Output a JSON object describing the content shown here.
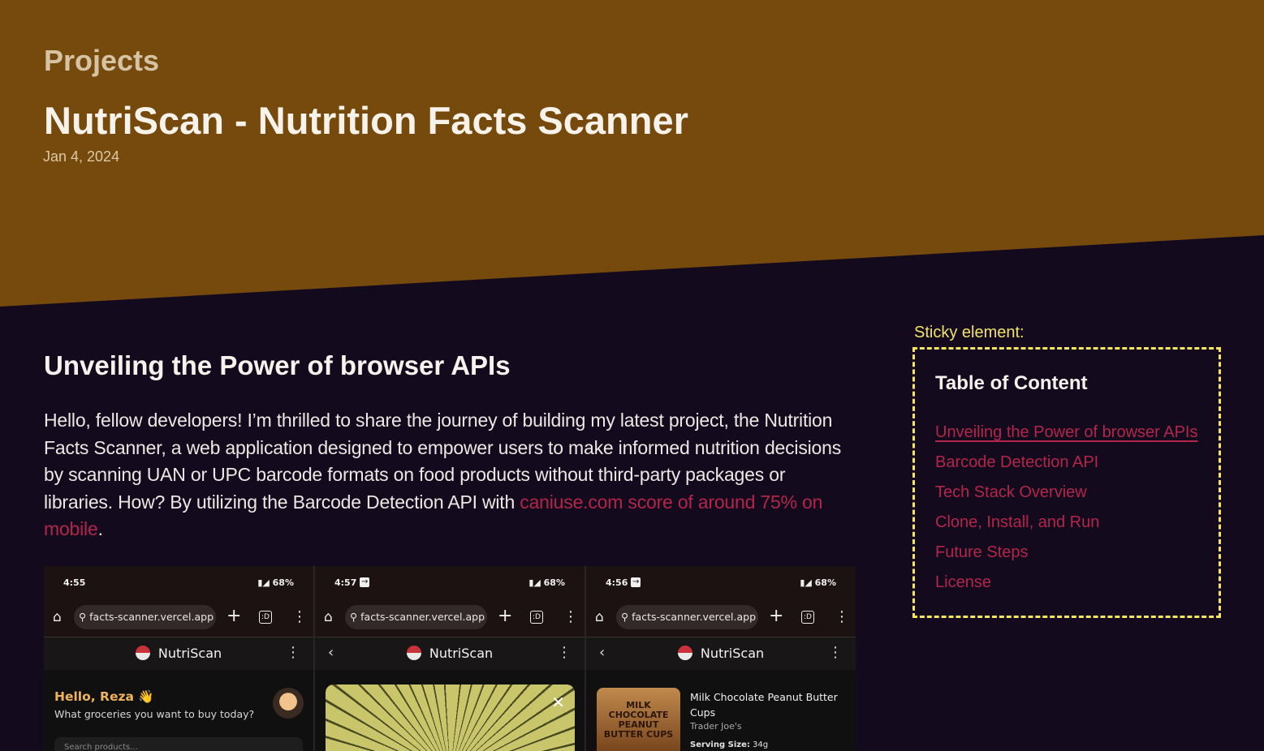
{
  "hero": {
    "section_label": "Projects",
    "title": "NutriScan - Nutrition Facts Scanner",
    "date": "Jan 4, 2024"
  },
  "article": {
    "heading": "Unveiling the Power of browser APIs",
    "intro_text": "Hello, fellow developers! I’m thrilled to share the journey of building my latest project, the Nutrition Facts Scanner, a web application designed to empower users to make informed nutrition decisions by scanning UAN or UPC barcode formats on food products without third-party packages or libraries. How? By utilizing the Barcode Detection API with ",
    "link_text": "caniuse.com score of around 75% on mobile",
    "trailing": "."
  },
  "screenshots": {
    "shared": {
      "url": "facts-scanner.vercel.app",
      "app_name": "NutriScan",
      "battery": "68%"
    },
    "phone1": {
      "time": "4:55",
      "greeting": "Hello, Reza 👋",
      "subtitle": "What groceries you want to buy today?",
      "search_placeholder": "Search products..."
    },
    "phone2": {
      "time": "4:57",
      "close_icon": "✕"
    },
    "phone3": {
      "time": "4:56",
      "product_name": "Milk Chocolate Peanut Butter Cups",
      "brand": "Trader Joe's",
      "serving_label": "Serving Size:",
      "serving_value": "34g",
      "package_text": "MILK CHOCOLATE PEANUT BUTTER CUPS"
    }
  },
  "sticky": {
    "label": "Sticky element:",
    "toc_title": "Table of Content",
    "items": [
      "Unveiling the Power of browser APIs",
      "Barcode Detection API",
      "Tech Stack Overview",
      "Clone, Install, and Run",
      "Future Steps",
      "License"
    ]
  },
  "colors": {
    "hero_bg": "#764a0d",
    "page_bg": "#130a1d",
    "link": "#b3264a",
    "sticky_border": "#f7e55f"
  }
}
